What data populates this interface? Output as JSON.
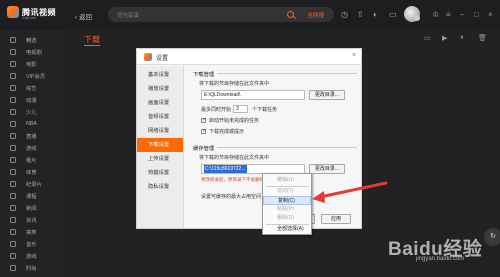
{
  "app": {
    "logo_text": "腾讯视频",
    "logo_sub": "v.qq.com",
    "back_label": "返回",
    "search_placeholder": "荷包蛋蛋",
    "search_scope": "全网搜"
  },
  "sidebar": {
    "items": [
      {
        "label": "精选",
        "icon": "home-icon"
      },
      {
        "label": "电视剧",
        "icon": "tv-icon"
      },
      {
        "label": "电影",
        "icon": "film-icon"
      },
      {
        "label": "VIP会员",
        "icon": "vip-icon"
      },
      {
        "label": "综艺",
        "icon": "variety-icon"
      },
      {
        "label": "动漫",
        "icon": "anime-icon"
      },
      {
        "label": "少儿",
        "icon": "kids-icon"
      },
      {
        "label": "NBA",
        "icon": "nba-icon"
      },
      {
        "label": "直播",
        "icon": "live-icon"
      },
      {
        "label": "游戏",
        "icon": "game-icon"
      },
      {
        "label": "看片",
        "icon": "watch-icon"
      },
      {
        "label": "体育",
        "icon": "sports-icon"
      },
      {
        "label": "纪录片",
        "icon": "documentary-icon"
      },
      {
        "label": "课程",
        "icon": "course-icon"
      },
      {
        "label": "新闻",
        "icon": "news-icon"
      },
      {
        "label": "资讯",
        "icon": "info-icon"
      },
      {
        "label": "搞笑",
        "icon": "funny-icon"
      },
      {
        "label": "音乐",
        "icon": "music-icon"
      },
      {
        "label": "游戏",
        "icon": "gamepad-icon"
      },
      {
        "label": "时尚",
        "icon": "fashion-icon"
      }
    ]
  },
  "main": {
    "title": "下载"
  },
  "dialog": {
    "title": "设置",
    "nav": [
      {
        "label": "基本设置",
        "active": false
      },
      {
        "label": "播放设置",
        "active": false
      },
      {
        "label": "画面设置",
        "active": false
      },
      {
        "label": "音频设置",
        "active": false
      },
      {
        "label": "网络设置",
        "active": false
      },
      {
        "label": "下载设置",
        "active": true
      },
      {
        "label": "上传设置",
        "active": false
      },
      {
        "label": "热键设置",
        "active": false
      },
      {
        "label": "隐私设置",
        "active": false
      }
    ],
    "download": {
      "group_title": "下载管理",
      "dir_label": "将下载的节目存储在此文件夹中",
      "dir_value": "E:\\QLDownload\\",
      "change_dir_button": "更改目录...",
      "concurrent_prefix": "最多同时开始",
      "concurrent_value": "3",
      "concurrent_suffix": "个下载任务",
      "auto_start_label": "启动开始未完成的任务",
      "notify_label": "下载完成或提示"
    },
    "cache": {
      "group_title": "缓存管理",
      "dir_label": "将下载的节目存储在此文件夹中",
      "dir_value": "C:\\115c8619722...",
      "change_dir_button": "更改目录...",
      "warning": "更改目录后，原目录下不会删除...",
      "size_label": "设置可缓存的最大占用空间"
    },
    "footer": {
      "cancel_button": "取消",
      "apply_button": "应用"
    }
  },
  "context_menu": {
    "items": [
      {
        "label": "撤销(U)",
        "enabled": false,
        "hover": false
      },
      {
        "label": "剪切(T)",
        "enabled": false,
        "hover": false
      },
      {
        "label": "复制(C)",
        "enabled": true,
        "hover": true
      },
      {
        "label": "粘贴(P)",
        "enabled": false,
        "hover": false
      },
      {
        "label": "删除(D)",
        "enabled": false,
        "hover": false
      },
      {
        "label": "全部选择(A)",
        "enabled": true,
        "hover": false
      }
    ]
  },
  "watermark": {
    "brand": "Baidu经验",
    "sub": "jingyan.baidu.com"
  },
  "colors": {
    "accent": "#ff6a00",
    "title_orange": "#ff5a2a",
    "arrow_red": "#e53935",
    "selection_blue": "#2f6ad6"
  }
}
